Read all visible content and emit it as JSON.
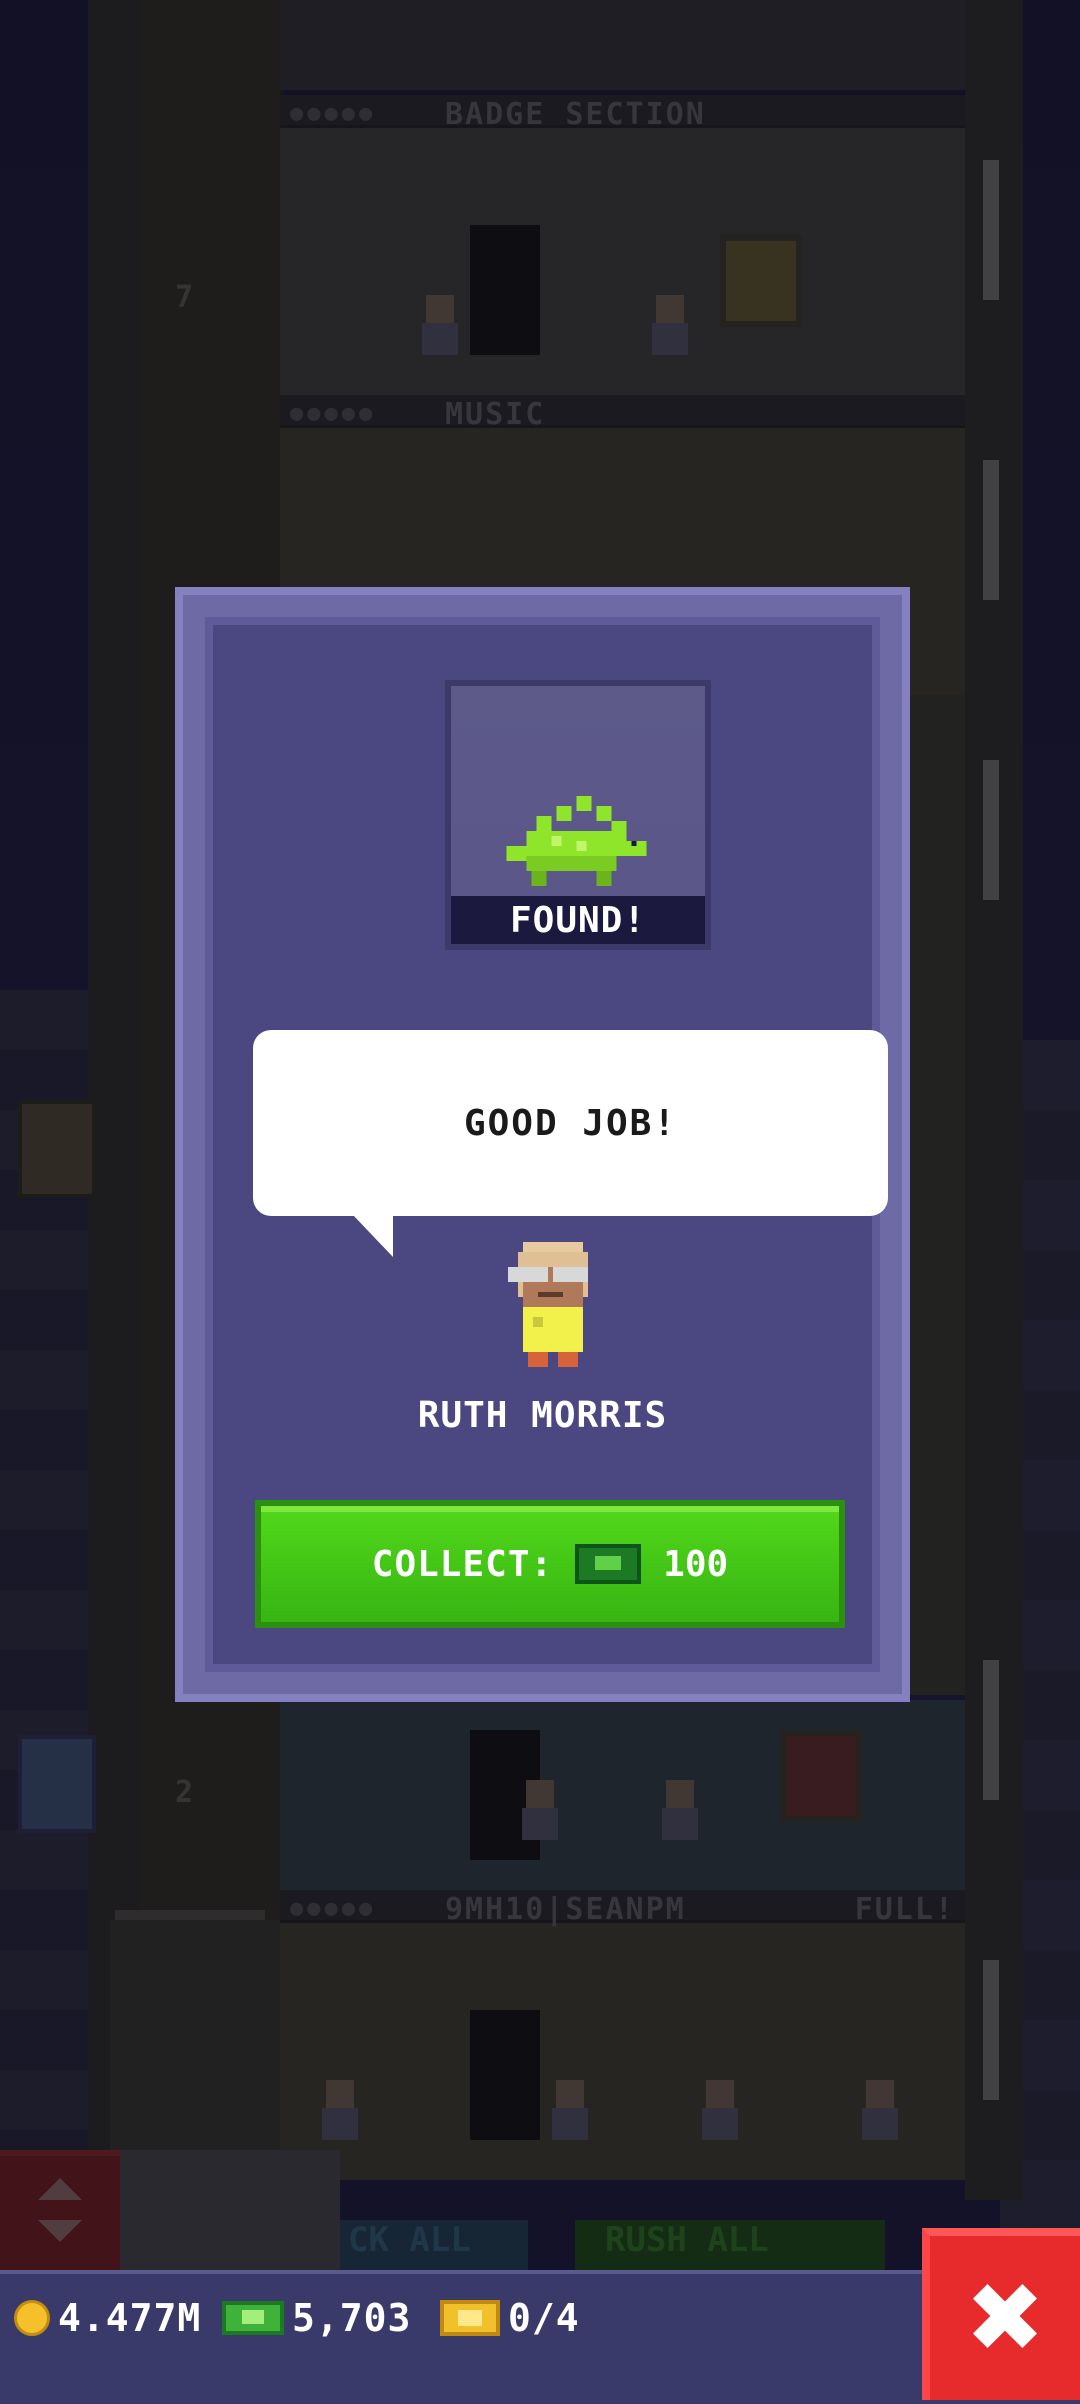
{
  "background": {
    "floors": [
      {
        "label": "BADGE SECTION",
        "right_label": ""
      },
      {
        "label": "MUSIC",
        "right_label": ""
      },
      {
        "label": "9MH10|SEANPM",
        "right_label": "FULL!"
      }
    ],
    "floor_numbers": [
      "7",
      "2"
    ],
    "ghost_buttons": {
      "stock_label": "CK ALL",
      "rush_label": "RUSH ALL"
    }
  },
  "modal": {
    "item_status": "FOUND!",
    "item_icon": "stegosaurus-icon",
    "speech": "GOOD JOB!",
    "npc_name": "RUTH MORRIS",
    "collect": {
      "label": "COLLECT:",
      "currency_icon": "bux-icon",
      "amount": "100"
    }
  },
  "bottom_bar": {
    "coins": "4.477M",
    "bux": "5,703",
    "tickets": "0/4",
    "close_icon": "close-icon"
  },
  "colors": {
    "modal": "#4b4780",
    "collect_green": "#45c817",
    "close_red": "#e72a2b",
    "stego_green": "#8ee52a"
  }
}
